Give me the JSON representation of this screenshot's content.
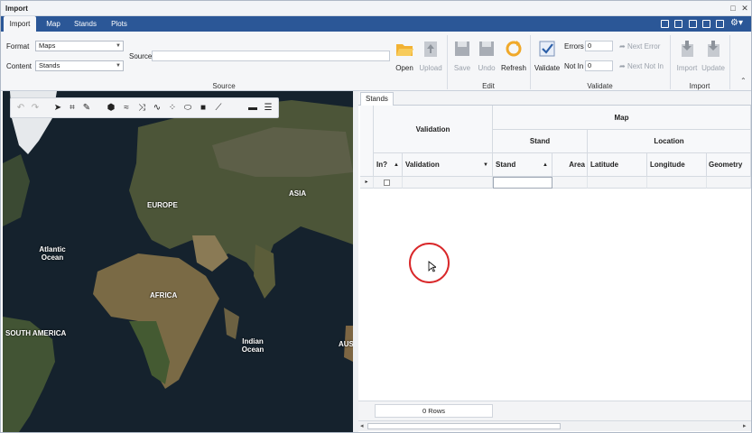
{
  "window": {
    "title": "Import"
  },
  "ribbon_tabs": [
    "Import",
    "Map",
    "Stands",
    "Plots"
  ],
  "source_group": {
    "format_label": "Format",
    "format_value": "Maps",
    "content_label": "Content",
    "content_value": "Stands",
    "source_label": "Source",
    "source_value": "",
    "group_label": "Source"
  },
  "buttons": {
    "open": "Open",
    "upload": "Upload",
    "save": "Save",
    "undo": "Undo",
    "refresh": "Refresh",
    "validate": "Validate",
    "import": "Import",
    "update": "Update",
    "next_error": "Next Error",
    "next_not_in": "Next Not In"
  },
  "edit_group_label": "Edit",
  "validate_group": {
    "errors_label": "Errors",
    "errors_value": "0",
    "not_in_label": "Not In",
    "not_in_value": "0",
    "group_label": "Validate"
  },
  "import_group_label": "Import",
  "map": {
    "labels": [
      "EUROPE",
      "ASIA",
      "Atlantic Ocean",
      "AFRICA",
      "SOUTH AMERICA",
      "Indian Ocean",
      "AUS"
    ]
  },
  "grid": {
    "tab": "Stands",
    "band_validation": "Validation",
    "band_map": "Map",
    "band_stand": "Stand",
    "band_location": "Location",
    "columns": [
      "In?",
      "Validation",
      "Stand",
      "Area",
      "Latitude",
      "Longitude",
      "Geometry"
    ],
    "row_count": "0 Rows"
  },
  "colors": {
    "ribbon_tab_bg": "#2b5797",
    "cursor_ring": "#d9282a"
  }
}
